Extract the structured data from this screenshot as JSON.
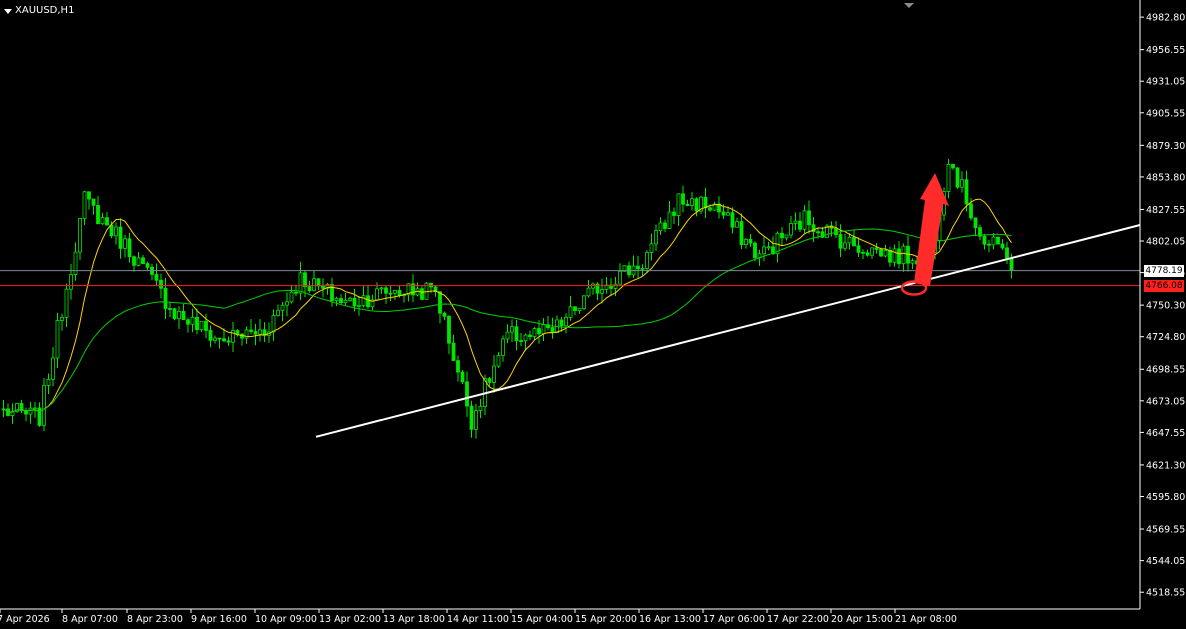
{
  "header": {
    "symbol_label": "XAUUSD,H1"
  },
  "price_tags": {
    "bid": "4778.19",
    "level": "4766.08"
  },
  "colors": {
    "background": "#000000",
    "candle_up": "#00e600",
    "candle_down": "#00e600",
    "ma_fast": "#ffd400",
    "ma_slow": "#00d000",
    "trendline": "#ffffff",
    "horizontal_level": "#ff2020",
    "bid_line": "#7f8c99",
    "annotation": "#ff2a2a"
  },
  "chart_data": {
    "type": "candlestick",
    "title": "XAUUSD,H1",
    "ylim": [
      4505.0,
      4995.0
    ],
    "y_ticks": [
      "4982.80",
      "4956.55",
      "4931.05",
      "4905.55",
      "4879.30",
      "4853.80",
      "4827.55",
      "4802.05",
      "4776.55",
      "4750.30",
      "4724.80",
      "4698.55",
      "4673.05",
      "4647.55",
      "4621.30",
      "4595.80",
      "4569.55",
      "4544.05",
      "4518.55"
    ],
    "x_ticks": [
      "7 Apr 2026",
      "8 Apr 07:00",
      "8 Apr 23:00",
      "9 Apr 16:00",
      "10 Apr 09:00",
      "13 Apr 02:00",
      "13 Apr 18:00",
      "14 Apr 11:00",
      "15 Apr 04:00",
      "15 Apr 20:00",
      "16 Apr 13:00",
      "17 Apr 06:00",
      "17 Apr 22:00",
      "20 Apr 15:00",
      "21 Apr 08:00"
    ],
    "bars": 225,
    "anchors": [
      [
        0,
        4665
      ],
      [
        8,
        4660
      ],
      [
        18,
        4835
      ],
      [
        28,
        4795
      ],
      [
        38,
        4745
      ],
      [
        48,
        4722
      ],
      [
        58,
        4730
      ],
      [
        66,
        4772
      ],
      [
        76,
        4752
      ],
      [
        86,
        4762
      ],
      [
        96,
        4762
      ],
      [
        104,
        4658
      ],
      [
        112,
        4725
      ],
      [
        122,
        4728
      ],
      [
        132,
        4765
      ],
      [
        142,
        4785
      ],
      [
        150,
        4835
      ],
      [
        158,
        4830
      ],
      [
        168,
        4790
      ],
      [
        178,
        4820
      ],
      [
        188,
        4800
      ],
      [
        198,
        4790
      ],
      [
        206,
        4790
      ],
      [
        210,
        4870
      ],
      [
        218,
        4800
      ],
      [
        226,
        4790
      ],
      [
        236,
        4795
      ],
      [
        242,
        4810
      ],
      [
        248,
        4790
      ],
      [
        252,
        4776
      ]
    ],
    "bid": 4778.19,
    "horizontal_level": 4766.08,
    "trendline": {
      "from": [
        "13 Apr 02:00",
        4644.0
      ],
      "to": [
        "chart right edge",
        4815.0
      ]
    },
    "indicators": [
      "moving average (yellow)",
      "moving average (green)"
    ],
    "annotations": [
      "red ellipse marking price at trendline",
      "red upward arrow"
    ]
  }
}
